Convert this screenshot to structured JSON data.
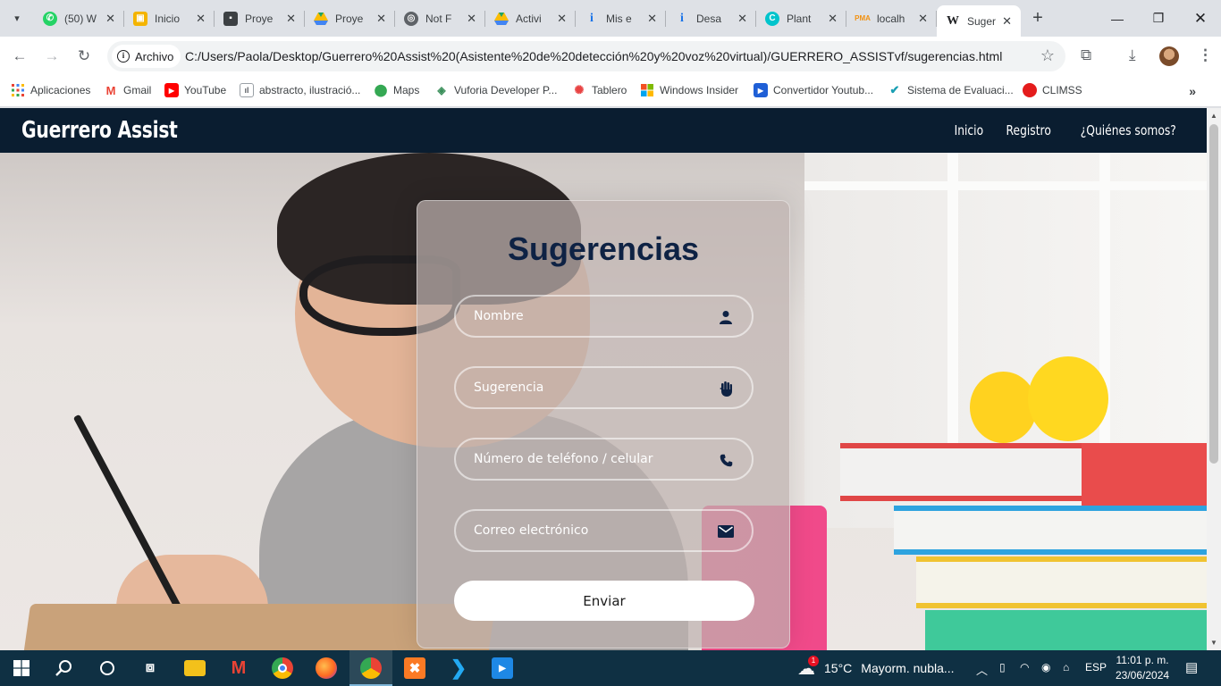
{
  "browser": {
    "tabs": [
      {
        "label": "(50) W",
        "favicon": "whatsapp-icon",
        "color": "#25d366"
      },
      {
        "label": "Inicio",
        "favicon": "classroom-icon",
        "color": "#f4b400"
      },
      {
        "label": "Proye",
        "favicon": "portrait-icon",
        "color": "#3c4043"
      },
      {
        "label": "Proye",
        "favicon": "drive-icon",
        "color": "#1fa463"
      },
      {
        "label": "Not F",
        "favicon": "globe-icon",
        "color": "#5f6368"
      },
      {
        "label": "Activi",
        "favicon": "drive-icon",
        "color": "#1fa463"
      },
      {
        "label": "Mis e",
        "favicon": "info-icon",
        "color": "#1a73e8"
      },
      {
        "label": "Desa",
        "favicon": "info-icon",
        "color": "#1a73e8"
      },
      {
        "label": "Plant",
        "favicon": "canva-icon",
        "color": "#00c4cc"
      },
      {
        "label": "localh",
        "favicon": "pma-icon",
        "color": "#f29111"
      }
    ],
    "active_tab": {
      "label": "Suger",
      "favicon": "wikipedia-icon"
    },
    "address_chip": "Archivo",
    "url": "C:/Users/Paola/Desktop/Guerrero%20Assist%20(Asistente%20de%20detección%20y%20voz%20virtual)/GUERRERO_ASSISTvf/sugerencias.html",
    "bookmarks": [
      {
        "label": "Aplicaciones",
        "icon": "apps-grid-icon"
      },
      {
        "label": "Gmail",
        "icon": "gmail-icon"
      },
      {
        "label": "YouTube",
        "icon": "youtube-icon"
      },
      {
        "label": "abstracto, ilustració...",
        "icon": "image-icon"
      },
      {
        "label": "Maps",
        "icon": "maps-pin-icon"
      },
      {
        "label": "Vuforia Developer P...",
        "icon": "vuforia-icon"
      },
      {
        "label": "Tablero",
        "icon": "tablero-icon"
      },
      {
        "label": "Windows Insider",
        "icon": "windows-logo-icon"
      },
      {
        "label": "Convertidor Youtub...",
        "icon": "converter-icon"
      },
      {
        "label": "Sistema de Evaluaci...",
        "icon": "checkmark-icon"
      },
      {
        "label": "CLIMSS",
        "icon": "climss-icon"
      }
    ]
  },
  "site": {
    "brand": "Guerrero Assist",
    "nav": [
      "Inicio",
      "Registro",
      "¿Quiénes somos?"
    ]
  },
  "form": {
    "title": "Sugerencias",
    "fields": [
      {
        "placeholder": "Nombre",
        "icon": "user-icon"
      },
      {
        "placeholder": "Sugerencia",
        "icon": "hand-icon"
      },
      {
        "placeholder": "Número de teléfono / celular",
        "icon": "phone-icon"
      },
      {
        "placeholder": "Correo electrónico",
        "icon": "envelope-icon"
      }
    ],
    "submit_label": "Enviar"
  },
  "taskbar": {
    "weather_temp": "15°C",
    "weather_text": "Mayorm. nubla...",
    "weather_badge": "1",
    "language": "ESP",
    "time": "11:01 p. m.",
    "date": "23/06/2024"
  }
}
